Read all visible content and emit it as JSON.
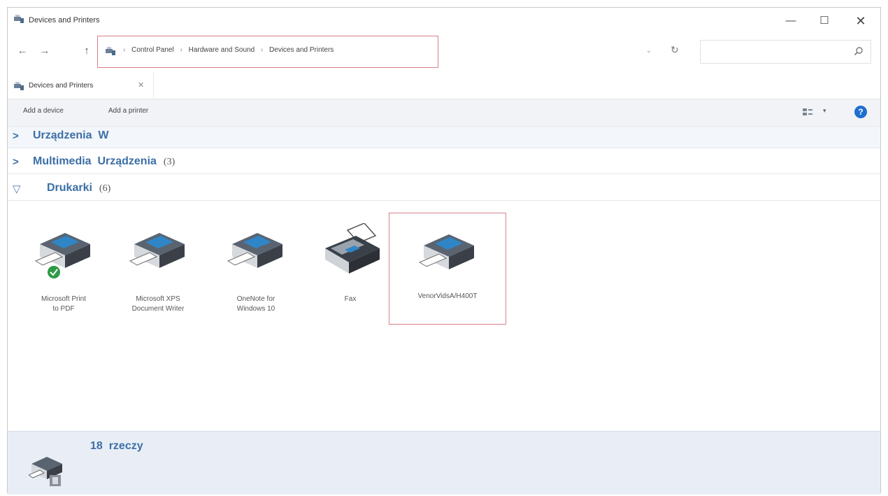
{
  "window": {
    "title": "Devices and Printers",
    "controls": {
      "minimize": "—",
      "maximize": "☐",
      "close": "✕"
    }
  },
  "nav": {
    "back": "←",
    "forward": "→",
    "up": "↑",
    "breadcrumb": [
      "Control Panel",
      "Hardware and Sound",
      "Devices and Printers"
    ],
    "dropdown": "⌄",
    "refresh": "↻",
    "search_placeholder": ""
  },
  "tab": {
    "label": "Devices and Printers",
    "close": "✕"
  },
  "commands": {
    "add_device": "Add a device",
    "add_printer": "Add a printer",
    "view_dropdown": "▾",
    "help": "?"
  },
  "groups": [
    {
      "chevron": ">",
      "label": "Urządzenia",
      "suffix": "W",
      "count": ""
    },
    {
      "chevron": ">",
      "label": "Multimedia",
      "suffix": "Urządzenia",
      "count": "(3)"
    },
    {
      "chevron": "▽",
      "label": "Drukarki",
      "suffix": "",
      "count": "(6)"
    }
  ],
  "devices": [
    {
      "name": "Microsoft Print to PDF",
      "line1": "Microsoft Print",
      "line2": "to PDF",
      "default": true,
      "icon": "printer-icon"
    },
    {
      "name": "Microsoft XPS Document Writer",
      "line1": "Microsoft XPS",
      "line2": "Document Writer",
      "default": false,
      "icon": "printer-icon"
    },
    {
      "name": "OneNote for Windows 10",
      "line1": "OneNote for",
      "line2": "Windows 10",
      "default": false,
      "icon": "printer-icon"
    },
    {
      "name": "Fax",
      "line1": "Fax",
      "line2": "",
      "default": false,
      "icon": "fax-icon"
    },
    {
      "name": "VenorVidsA/H400T",
      "line1": "VenorVidsA/H400T",
      "line2": "",
      "default": false,
      "icon": "printer-icon"
    }
  ],
  "details": {
    "count": "18",
    "label": "rzeczy"
  },
  "colors": {
    "accent": "#3c6fa6",
    "highlight_border": "#d9808a",
    "help": "#1e6fd0",
    "default_check": "#2e9a47"
  }
}
